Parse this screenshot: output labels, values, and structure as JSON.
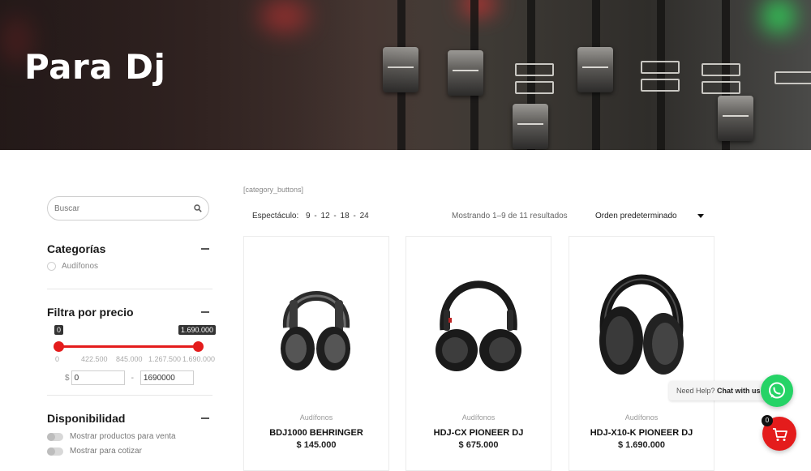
{
  "hero": {
    "title": "Para Dj"
  },
  "sidebar": {
    "search_placeholder": "Buscar",
    "categories": {
      "title": "Categorías",
      "items": [
        "Audífonos"
      ]
    },
    "price_filter": {
      "title": "Filtra por precio",
      "min_tip": "0",
      "max_tip": "1.690.000",
      "ticks": [
        "0",
        "422.500",
        "845.000",
        "1.267.500",
        "1.690.000"
      ],
      "currency": "$",
      "min_value": "0",
      "separator": "-",
      "max_value": "1690000"
    },
    "availability": {
      "title": "Disponibilidad",
      "options": [
        "Mostrar productos para venta",
        "Mostrar para cotizar"
      ]
    }
  },
  "main": {
    "shortcode": "[category_buttons]",
    "per_page_label": "Espectáculo:",
    "per_page_options": [
      "9",
      "12",
      "18",
      "24"
    ],
    "result_count": "Mostrando 1–9 de 11 resultados",
    "orderby": "Orden predeterminado",
    "products": [
      {
        "category": "Audífonos",
        "name": "BDJ1000 BEHRINGER",
        "price": "$ 145.000"
      },
      {
        "category": "Audífonos",
        "name": "HDJ-CX PIONEER DJ",
        "price": "$ 675.000"
      },
      {
        "category": "Audífonos",
        "name": "HDJ-X10-K PIONEER DJ",
        "price": "$ 1.690.000"
      }
    ]
  },
  "floating": {
    "help_text": "Need Help?",
    "help_bold": "Chat with us",
    "cart_count": "0"
  },
  "colors": {
    "accent": "#e41c1c",
    "whatsapp": "#25d366"
  }
}
